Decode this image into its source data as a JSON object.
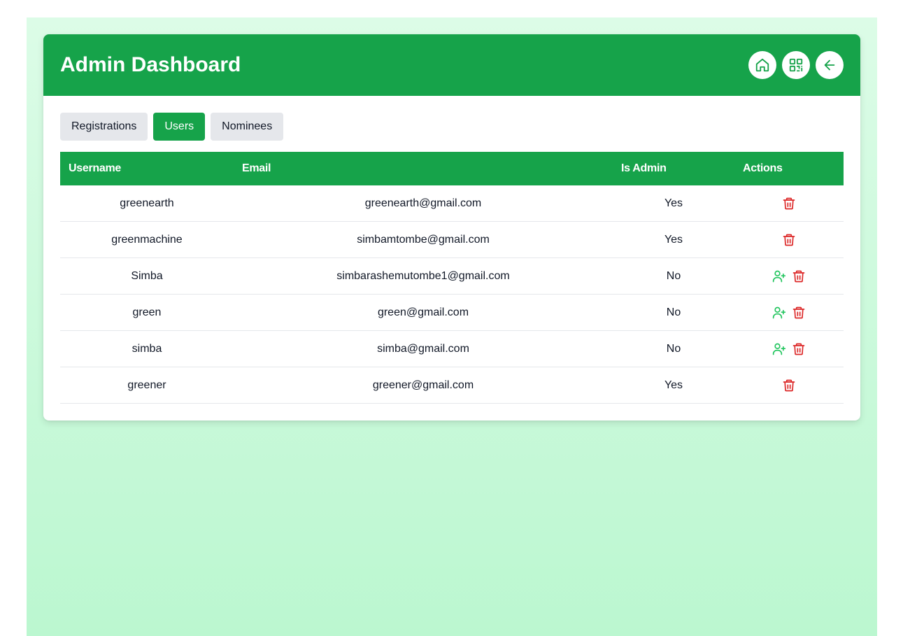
{
  "header": {
    "title": "Admin Dashboard",
    "buttons": [
      "home-icon",
      "qr-code-icon",
      "arrow-left-icon"
    ]
  },
  "tabs": [
    {
      "label": "Registrations",
      "active": false
    },
    {
      "label": "Users",
      "active": true
    },
    {
      "label": "Nominees",
      "active": false
    }
  ],
  "table": {
    "columns": [
      "Username",
      "Email",
      "Is Admin",
      "Actions"
    ],
    "rows": [
      {
        "username": "greenearth",
        "email": "greenearth@gmail.com",
        "is_admin": "Yes",
        "actions": [
          "trash-icon"
        ]
      },
      {
        "username": "greenmachine",
        "email": "simbamtombe@gmail.com",
        "is_admin": "Yes",
        "actions": [
          "trash-icon"
        ]
      },
      {
        "username": "Simba",
        "email": "simbarashemutombe1@gmail.com",
        "is_admin": "No",
        "actions": [
          "user-plus-icon",
          "trash-icon"
        ]
      },
      {
        "username": "green",
        "email": "green@gmail.com",
        "is_admin": "No",
        "actions": [
          "user-plus-icon",
          "trash-icon"
        ]
      },
      {
        "username": "simba",
        "email": "simba@gmail.com",
        "is_admin": "No",
        "actions": [
          "user-plus-icon",
          "trash-icon"
        ]
      },
      {
        "username": "greener",
        "email": "greener@gmail.com",
        "is_admin": "Yes",
        "actions": [
          "trash-icon"
        ]
      }
    ]
  },
  "colors": {
    "primary": "#16a34a",
    "danger": "#dc2626",
    "success_icon": "#22c55e",
    "tab_inactive": "#e5e7eb",
    "background": "#dcfce7"
  }
}
